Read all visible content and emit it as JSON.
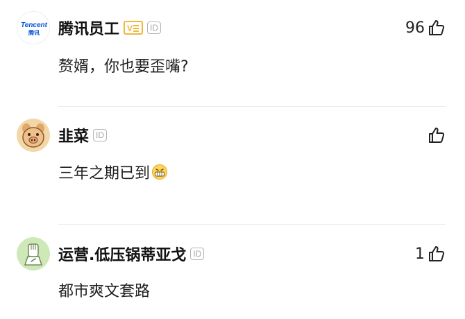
{
  "comments": [
    {
      "author": "腾讯员工",
      "avatar_text": "Tencent",
      "avatar_subtext": "腾讯",
      "verified_badge": "V",
      "id_badge": "ID",
      "likes": "96",
      "text": "赘婿，你也要歪嘴?"
    },
    {
      "author": "韭菜",
      "avatar_icon": "pig-face-icon",
      "id_badge": "ID",
      "likes": "",
      "text": "三年之期已到",
      "emoji": "grin-emoji-icon"
    },
    {
      "author": "运营.低压锅蒂亚戈",
      "avatar_icon": "hand-paper-icon",
      "id_badge": "ID",
      "likes": "1",
      "text": "都市爽文套路"
    }
  ],
  "colors": {
    "verified": "#f2b63a",
    "tencent_blue": "#0052d9",
    "pig_bg": "#f3d7a8",
    "hand_bg": "#cfe8b8"
  }
}
